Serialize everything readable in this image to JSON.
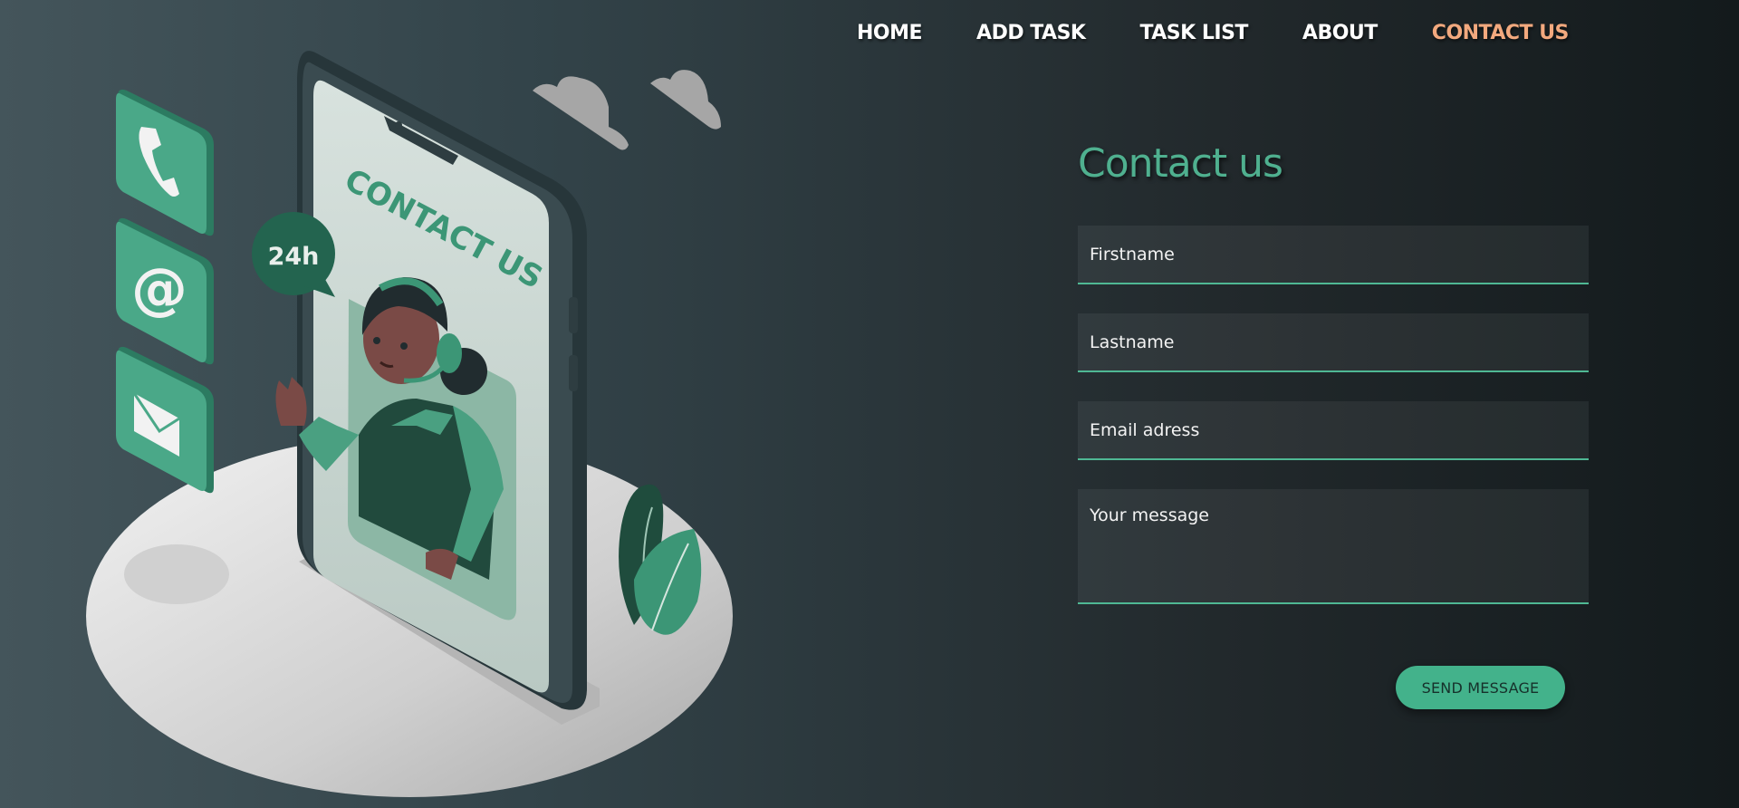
{
  "nav": {
    "items": [
      {
        "label": "HOME",
        "active": false
      },
      {
        "label": "ADD TASK",
        "active": false
      },
      {
        "label": "TASK LIST",
        "active": false
      },
      {
        "label": "ABOUT",
        "active": false
      },
      {
        "label": "CONTACT US",
        "active": true
      }
    ]
  },
  "illustration": {
    "phone_banner": "CONTACT US",
    "badge": "24h",
    "icons": [
      "phone-icon",
      "at-sign-icon",
      "envelope-icon"
    ]
  },
  "form": {
    "title": "Contact us",
    "firstname_placeholder": "Firstname",
    "lastname_placeholder": "Lastname",
    "email_placeholder": "Email adress",
    "message_placeholder": "Your message",
    "submit_label": "SEND MESSAGE"
  },
  "colors": {
    "accent": "#4fb08f",
    "nav_active": "#f2a97e",
    "button": "#43b28b"
  }
}
